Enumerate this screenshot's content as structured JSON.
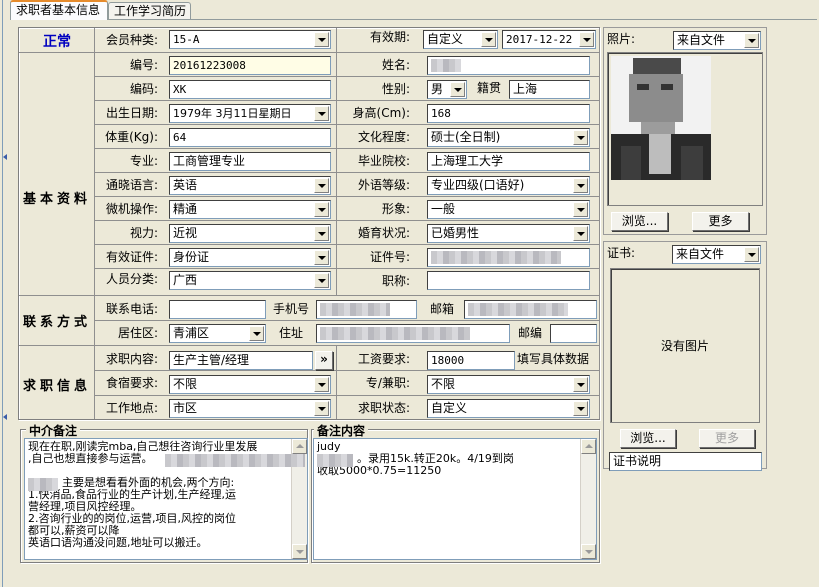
{
  "tabs": [
    "求职者基本信息",
    "工作学习简历"
  ],
  "status": "正常",
  "sections": {
    "basic": "基本资料",
    "contact": "联系方式",
    "job": "求职信息"
  },
  "labels": {
    "member_type": "会员种类:",
    "validity": "有效期:",
    "number": "编号:",
    "name": "姓名:",
    "code": "编码:",
    "gender": "性别:",
    "native": "籍贯",
    "birth": "出生日期:",
    "height": "身高(Cm):",
    "weight": "体重(Kg):",
    "education": "文化程度:",
    "major": "专业:",
    "school": "毕业院校:",
    "language": "通晓语言:",
    "lang_level": "外语等级:",
    "computer": "微机操作:",
    "image": "形象:",
    "vision": "视力:",
    "marriage": "婚育状况:",
    "id_doc": "有效证件:",
    "id_no": "证件号:",
    "category": "人员分类:",
    "title": "职称:",
    "phone": "联系电话:",
    "mobile": "手机号",
    "email": "邮箱",
    "district": "居住区:",
    "address": "住址",
    "postcode": "邮编",
    "job_content": "求职内容:",
    "salary": "工资要求:",
    "food": "食宿要求:",
    "fulltime": "专/兼职:",
    "location": "工作地点:",
    "job_status": "求职状态:",
    "agent_notes": "中介备注",
    "remark": "备注内容",
    "photo": "照片:",
    "cert": "证书:"
  },
  "values": {
    "member_type": "15-A",
    "validity_type": "自定义",
    "validity_date": "2017-12-22",
    "number": "20161223008",
    "name": "",
    "code": "XK",
    "gender": "男",
    "native": "上海",
    "birth": "1979年 3月11日星期日",
    "height": "168",
    "weight": "64",
    "education": "硕士(全日制)",
    "major": "工商管理专业",
    "school": "上海理工大学",
    "language": "英语",
    "lang_level": "专业四级(口语好)",
    "computer": "精通",
    "image": "一般",
    "vision": "近视",
    "marriage": "已婚男性",
    "id_doc": "身份证",
    "id_no": "",
    "category": "广西",
    "title": "",
    "phone": "",
    "mobile": "",
    "email": "",
    "district": "青浦区",
    "address": "",
    "postcode": "",
    "job_content": "生产主管/经理",
    "salary": "18000",
    "salary_note": "填写具体数据",
    "food": "不限",
    "fulltime": "不限",
    "location": "市区",
    "job_status": "自定义"
  },
  "agent_notes_lines": [
    "现在在职,刚读完mba,自己想往咨询行业里发展",
    ",自己也想直接参与运营。",
    "",
    "主要是想看看外面的机会,两个方向:",
    "1.快消品,食品行业的生产计划,生产经理,运",
    "营经理,项目风控经理。",
    "2.咨询行业的的岗位,运营,项目,风控的岗位",
    "都可以,薪资可以降",
    "英语口语沟通没问题,地址可以搬迁。"
  ],
  "remark_lines": [
    "judy",
    "。录用15k.转正20k。4/19到岗",
    "收取5000*0.75=11250"
  ],
  "photo_source": "来自文件",
  "cert_source": "来自文件",
  "buttons": {
    "browse": "浏览...",
    "more": "更多",
    "expand": "»"
  },
  "no_image": "没有图片",
  "cert_desc": "证书说明"
}
